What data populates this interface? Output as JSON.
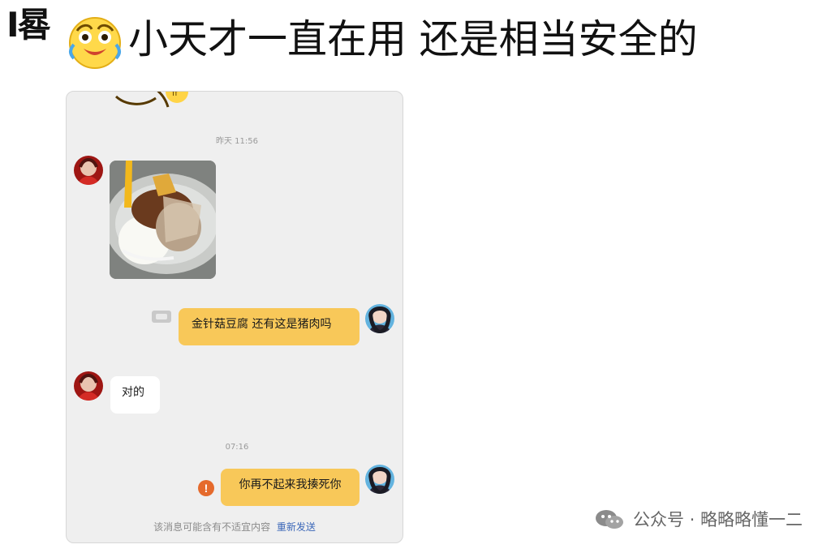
{
  "header": {
    "left_fragment": "I晷",
    "headline": "小天才一直在用 还是相当安全的"
  },
  "chat": {
    "timestamp_1": "昨天 11:56",
    "message_1": "金针菇豆腐 还有这是猪肉吗",
    "message_2": "对的",
    "timestamp_2": "07:16",
    "message_3": "你再不起来我揍死你",
    "error_icon_text": "!",
    "notice_text": "该消息可能含有不适宜内容",
    "resend_text": "重新发送"
  },
  "watermark": {
    "text": "公众号 · 略略略懂一二"
  },
  "colors": {
    "card_background": "#efefef",
    "yellow_bubble": "#f8c859",
    "white_bubble": "#ffffff",
    "error_icon": "#e56a2c",
    "resend_link": "#3b67b8"
  }
}
